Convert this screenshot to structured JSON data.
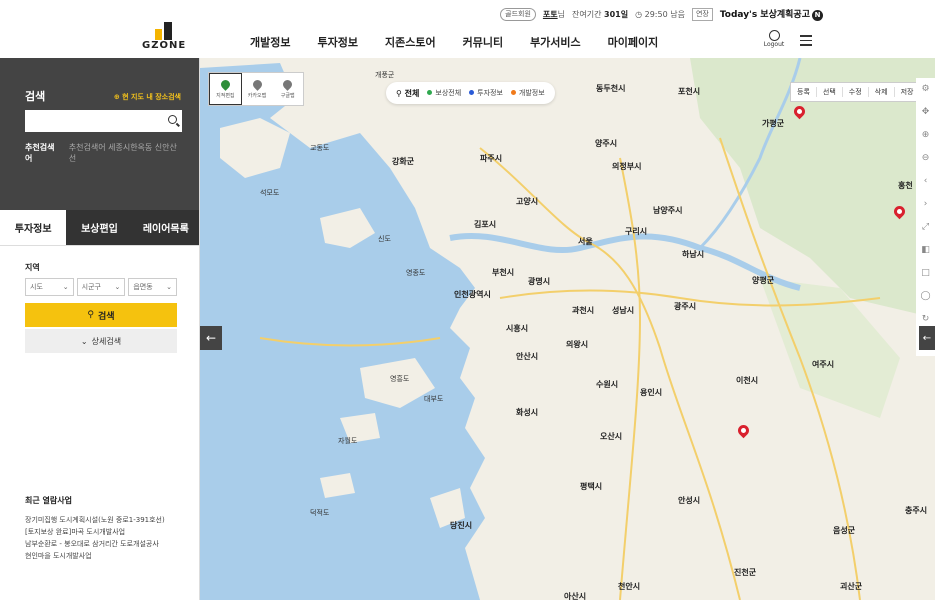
{
  "topbar": {
    "gold_member": "골드회원",
    "user": "포토",
    "user_suffix": "님",
    "period_label": "잔여기간",
    "period_value": "301일",
    "time": "29:50 남음",
    "extend": "연장",
    "today_label": "Today's 보상계획공고",
    "today_badge": "N"
  },
  "header": {
    "logo_text": "GZONE",
    "nav": [
      "개발정보",
      "투자정보",
      "지존스토어",
      "커뮤니티",
      "부가서비스",
      "마이페이지"
    ],
    "logout": "Logout"
  },
  "sidebar": {
    "search_title": "검색",
    "location_search": "현 지도 내 장소검색",
    "search_placeholder": "",
    "recommend_label": "추천검색어",
    "recommend_text": "추천검색어 세종시한옥동 신안산선",
    "tabs": [
      {
        "label": "투자정보",
        "active": true
      },
      {
        "label": "보상편입",
        "active": false
      },
      {
        "label": "레이어목록",
        "active": false
      }
    ],
    "region_label": "지역",
    "selects": [
      "시도",
      "시군구",
      "읍면동"
    ],
    "search_button": "검색",
    "detail_button": "상세검색",
    "recent_title": "최근 열람사업",
    "recent_items": [
      "장기미집행 도시계획시설(노원 중로1-391호선)",
      "[토지보상 완료]마곡 도시개발사업",
      "남부순환로 - 봉오대로 삼거리간 도로개설공사",
      "현인마을 도시개발사업"
    ]
  },
  "map": {
    "map_types": [
      "지적편집",
      "카카오맵",
      "구글맵"
    ],
    "filter_all": "전체",
    "filters": [
      {
        "label": "보상전체",
        "color": "#2fa84f"
      },
      {
        "label": "투자정보",
        "color": "#2a5bd7"
      },
      {
        "label": "개발정보",
        "color": "#f07a1a"
      }
    ],
    "edit_tools": [
      "등록",
      "선택",
      "수정",
      "삭제",
      "저장"
    ],
    "tool_icons": [
      "settings-icon",
      "move-icon",
      "zoom-in-icon",
      "zoom-out-icon",
      "prev-icon",
      "next-icon",
      "fullscreen-icon",
      "layer-icon",
      "square-icon",
      "circle-icon",
      "refresh-icon",
      "edit-icon",
      "bus-icon"
    ],
    "places": [
      {
        "name": "개풍군",
        "big": false
      },
      {
        "name": "동두천시",
        "big": true
      },
      {
        "name": "포천시",
        "big": true
      },
      {
        "name": "가평군",
        "big": true
      },
      {
        "name": "파주시",
        "big": true
      },
      {
        "name": "양주시",
        "big": true
      },
      {
        "name": "의정부시",
        "big": true
      },
      {
        "name": "강화군",
        "big": true
      },
      {
        "name": "고양시",
        "big": true
      },
      {
        "name": "김포시",
        "big": true
      },
      {
        "name": "남양주시",
        "big": true
      },
      {
        "name": "구리시",
        "big": true
      },
      {
        "name": "서울",
        "big": true
      },
      {
        "name": "하남시",
        "big": true
      },
      {
        "name": "양평군",
        "big": true
      },
      {
        "name": "부천시",
        "big": true
      },
      {
        "name": "광명시",
        "big": true
      },
      {
        "name": "인천광역시",
        "big": true
      },
      {
        "name": "과천시",
        "big": true
      },
      {
        "name": "성남시",
        "big": true
      },
      {
        "name": "광주시",
        "big": true
      },
      {
        "name": "시흥시",
        "big": true
      },
      {
        "name": "안산시",
        "big": true
      },
      {
        "name": "의왕시",
        "big": true
      },
      {
        "name": "수원시",
        "big": true
      },
      {
        "name": "용인시",
        "big": true
      },
      {
        "name": "이천시",
        "big": true
      },
      {
        "name": "여주시",
        "big": true
      },
      {
        "name": "화성시",
        "big": true
      },
      {
        "name": "오산시",
        "big": true
      },
      {
        "name": "평택시",
        "big": true
      },
      {
        "name": "안성시",
        "big": true
      },
      {
        "name": "당진시",
        "big": true
      },
      {
        "name": "충주시",
        "big": true
      },
      {
        "name": "음성군",
        "big": true
      },
      {
        "name": "진천군",
        "big": true
      },
      {
        "name": "천안시",
        "big": true
      },
      {
        "name": "아산시",
        "big": true
      },
      {
        "name": "괴산군",
        "big": true
      },
      {
        "name": "홍천",
        "big": true
      },
      {
        "name": "영종도",
        "big": false
      },
      {
        "name": "영흥도",
        "big": false
      },
      {
        "name": "대부도",
        "big": false
      },
      {
        "name": "교동도",
        "big": false
      },
      {
        "name": "신도",
        "big": false
      },
      {
        "name": "석모도",
        "big": false
      },
      {
        "name": "덕적도",
        "big": false
      },
      {
        "name": "자월도",
        "big": false
      }
    ]
  }
}
